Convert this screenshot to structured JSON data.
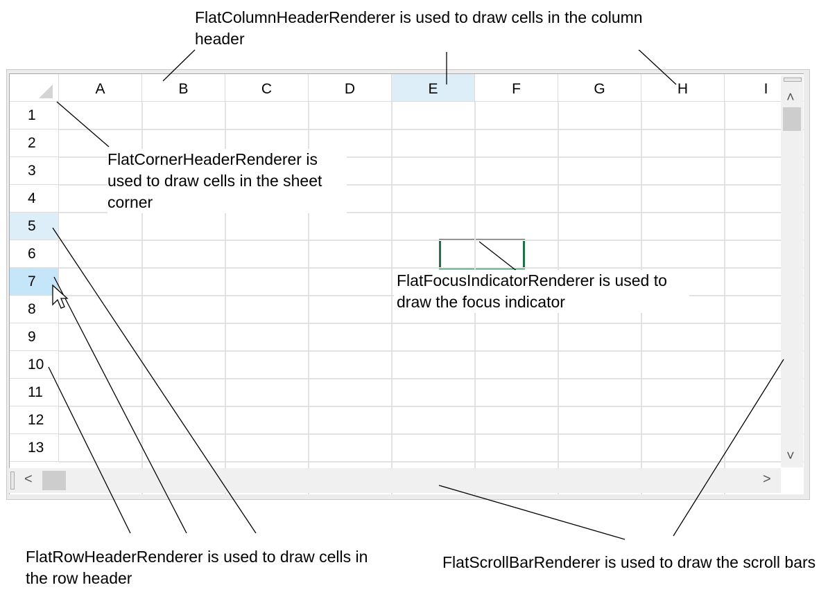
{
  "columns": [
    {
      "label": "A",
      "selected": false
    },
    {
      "label": "B",
      "selected": false
    },
    {
      "label": "C",
      "selected": false
    },
    {
      "label": "D",
      "selected": false
    },
    {
      "label": "E",
      "selected": true
    },
    {
      "label": "F",
      "selected": false
    },
    {
      "label": "G",
      "selected": false
    },
    {
      "label": "H",
      "selected": false
    },
    {
      "label": "I",
      "selected": false
    }
  ],
  "rows": [
    {
      "label": "1",
      "state": ""
    },
    {
      "label": "2",
      "state": ""
    },
    {
      "label": "3",
      "state": ""
    },
    {
      "label": "4",
      "state": ""
    },
    {
      "label": "5",
      "state": "sel"
    },
    {
      "label": "6",
      "state": ""
    },
    {
      "label": "7",
      "state": "hot"
    },
    {
      "label": "8",
      "state": ""
    },
    {
      "label": "9",
      "state": ""
    },
    {
      "label": "10",
      "state": ""
    },
    {
      "label": "11",
      "state": ""
    },
    {
      "label": "12",
      "state": ""
    },
    {
      "label": "13",
      "state": ""
    }
  ],
  "callouts": {
    "column_header": "FlatColumnHeaderRenderer is used to draw cells in the column header",
    "corner_header": "FlatCornerHeaderRenderer is used to draw cells in the sheet corner",
    "focus_indicator": "FlatFocusIndicatorRenderer is used to draw the focus indicator",
    "row_header": "FlatRowHeaderRenderer is used to draw cells in the row header",
    "scroll_bar": "FlatScrollBarRenderer is used to draw the scroll bars"
  },
  "scroll": {
    "up_icon": "chevron-up-icon",
    "down_icon": "chevron-down-icon",
    "left_icon": "chevron-left-icon",
    "right_icon": "chevron-right-icon"
  },
  "colors": {
    "header_selected": "#ddeef8",
    "row_hover": "#c5e6f8",
    "focus_border": "#217346",
    "grid_line": "#e2e2e2"
  }
}
